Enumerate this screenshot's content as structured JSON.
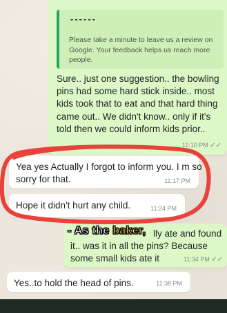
{
  "messages": [
    {
      "id": "m1",
      "direction": "outgoing",
      "quote": {
        "title": "------",
        "text": "Please take a minute to leave us a review on Google. Your feedback helps us reach more people."
      },
      "text": "Sure.. just one suggestion.. the bowling pins had some hard stick inside.. most kids took that to eat and that hard thing came out.. We didn't know.. only if it's told then we could inform kids prior..",
      "time": "11:10 PM",
      "status": "read"
    },
    {
      "id": "m2",
      "direction": "incoming",
      "text": "Yea yes Actually I forgot to inform you. I m so sorry for that.",
      "time": "11:17 PM"
    },
    {
      "id": "m3",
      "direction": "incoming",
      "text": "Hope it didn't hurt any child.",
      "time": "11:24 PM"
    },
    {
      "id": "m4",
      "direction": "outgoing",
      "text": "lly ate and found it.. was it in all the pins? Because some small kids ate it",
      "time": "11:34 PM",
      "status": "read"
    },
    {
      "id": "m5",
      "direction": "incoming",
      "text": "Yes..to hold the head of pins.",
      "time": "11:38 PM"
    }
  ],
  "overlay_caption": {
    "prefix": "- As the ",
    "highlight": "baker,"
  },
  "colors": {
    "outgoing_bubble": "#dcf8c6",
    "incoming_bubble": "#ffffff",
    "quote_bar": "#25a45a",
    "highlight_stroke": "#e8423b",
    "caption_highlight": "#f6d245"
  },
  "icons": {
    "read_receipt": "double-check-icon"
  }
}
